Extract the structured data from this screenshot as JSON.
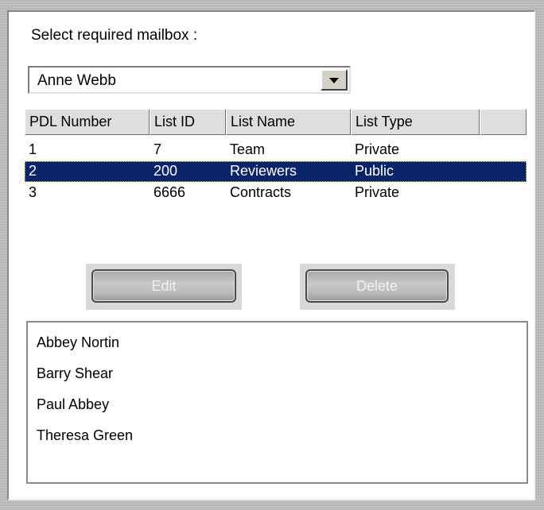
{
  "mailbox_section": {
    "label": "Select required mailbox :",
    "selected_mailbox": "Anne Webb"
  },
  "table": {
    "columns": [
      "PDL Number",
      "List ID",
      "List Name",
      "List Type",
      ""
    ],
    "rows": [
      {
        "pdl_number": "1",
        "list_id": "7",
        "list_name": "Team",
        "list_type": "Private",
        "selected": false
      },
      {
        "pdl_number": "2",
        "list_id": "200",
        "list_name": "Reviewers",
        "list_type": "Public",
        "selected": true
      },
      {
        "pdl_number": "3",
        "list_id": "6666",
        "list_name": "Contracts",
        "list_type": "Private",
        "selected": false
      }
    ]
  },
  "actions": {
    "edit_label": "Edit",
    "delete_label": "Delete"
  },
  "members": [
    "Abbey Nortin",
    "Barry Shear",
    "Paul Abbey",
    "Theresa Green"
  ],
  "colors": {
    "selection_background": "#0a246a",
    "selection_text": "#ffffff",
    "disabled_text": "#efefef"
  }
}
